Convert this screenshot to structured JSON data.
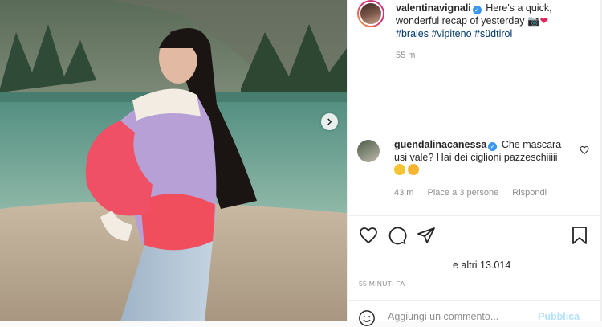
{
  "post": {
    "author": {
      "username": "valentinavignali",
      "verified": true,
      "caption_line1": "Here's a quick,",
      "caption_line2": "wonderful recap of yesterday",
      "hashtags": [
        "#braies",
        "#vipiteno",
        "#südtirol"
      ],
      "time_ago": "55 m"
    },
    "comment": {
      "username": "guendalinacanessa",
      "verified": true,
      "text_line1": "Che mascara",
      "text_line2": "usi vale? Hai dei ciglioni pazzeschiiiii",
      "time_ago": "43 m",
      "likes": "Piace a 3 persone",
      "reply": "Rispondi"
    },
    "likes_text": "e altri 13.014",
    "posted": "55 MINUTI FA",
    "add_comment": {
      "placeholder": "Aggiungi un commento...",
      "publish": "Pubblica"
    }
  },
  "icons": {
    "like": "heart-icon",
    "comment": "comment-icon",
    "share": "send-icon",
    "save": "bookmark-icon",
    "next": "chevron-right-icon",
    "emoji": "smile-icon"
  },
  "colors": {
    "accent": "#3897f0",
    "hashtag": "#00376b",
    "muted": "#8e8e8e",
    "publish_disabled": "#b2dffc"
  }
}
